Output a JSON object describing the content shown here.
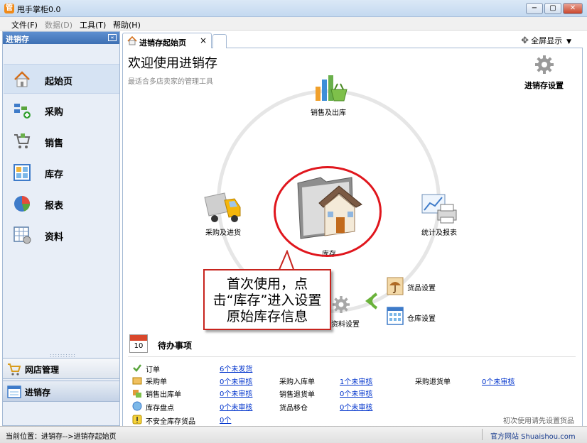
{
  "window": {
    "app_icon": "管",
    "title": "甩手掌柜0.0",
    "minimize": "−",
    "maximize": "▢",
    "close": "✕"
  },
  "menu": [
    {
      "label": "文件(F)",
      "enabled": true
    },
    {
      "label": "数据(D)",
      "enabled": false
    },
    {
      "label": "工具(T)",
      "enabled": true
    },
    {
      "label": "帮助(H)",
      "enabled": true
    }
  ],
  "sidebar": {
    "header": "进销存",
    "collapse": "«",
    "items": [
      {
        "label": "起始页",
        "icon": "home-icon",
        "active": true
      },
      {
        "label": "采购",
        "icon": "purchase-icon",
        "active": false
      },
      {
        "label": "销售",
        "icon": "cart-icon",
        "active": false
      },
      {
        "label": "库存",
        "icon": "inventory-grid-icon",
        "active": false
      },
      {
        "label": "报表",
        "icon": "pie-chart-icon",
        "active": false
      },
      {
        "label": "资料",
        "icon": "data-grid-icon",
        "active": false
      }
    ],
    "bottom": [
      {
        "label": "网店管理",
        "icon": "shop-cart-icon",
        "active": false
      },
      {
        "label": "进销存",
        "icon": "inventory-window-icon",
        "active": true
      }
    ]
  },
  "tabs": {
    "active_label": "进销存起始页",
    "close": "×"
  },
  "fullscreen": {
    "label": "全屏显示",
    "icon": "move-icon",
    "arrow": "▼"
  },
  "main": {
    "title": "欢迎使用进销存",
    "subtitle": "最适合多店卖家的管理工具",
    "settings_label": "进销存设置",
    "hub": {
      "top": "销售及出库",
      "left": "采购及进货",
      "right": "统计及报表",
      "center": "库存",
      "bottom": "资料设置"
    },
    "side_items": [
      {
        "label": "货品设置",
        "icon": "umbrella-icon"
      },
      {
        "label": "仓库设置",
        "icon": "warehouse-grid-icon"
      }
    ],
    "callout": "首次使用，点击“库存”进入设置原始库存信息"
  },
  "todo": {
    "calendar_day": "10",
    "title": "待办事项",
    "rows": [
      {
        "label": "订单",
        "link": "6个未发货"
      },
      {
        "label": "采购单",
        "link": "0个未审核"
      },
      {
        "label": "销售出库单",
        "link": "0个未审核"
      },
      {
        "label": "库存盘点",
        "link": "0个未审核"
      },
      {
        "label": "不安全库存货品",
        "link": "0个"
      }
    ],
    "col2": [
      {
        "label": "采购入库单",
        "link": "1个未审核"
      },
      {
        "label": "销售退货单",
        "link": "0个未审核"
      },
      {
        "label": "货品移仓",
        "link": "0个未审核"
      }
    ],
    "col3": [
      {
        "label": "采购退货单",
        "link": "0个未审核"
      }
    ],
    "hint": "初次使用请先设置货品"
  },
  "status": {
    "location": "当前位置：进销存-->进销存起始页",
    "site": "官方网站 Shuaishou.com"
  }
}
